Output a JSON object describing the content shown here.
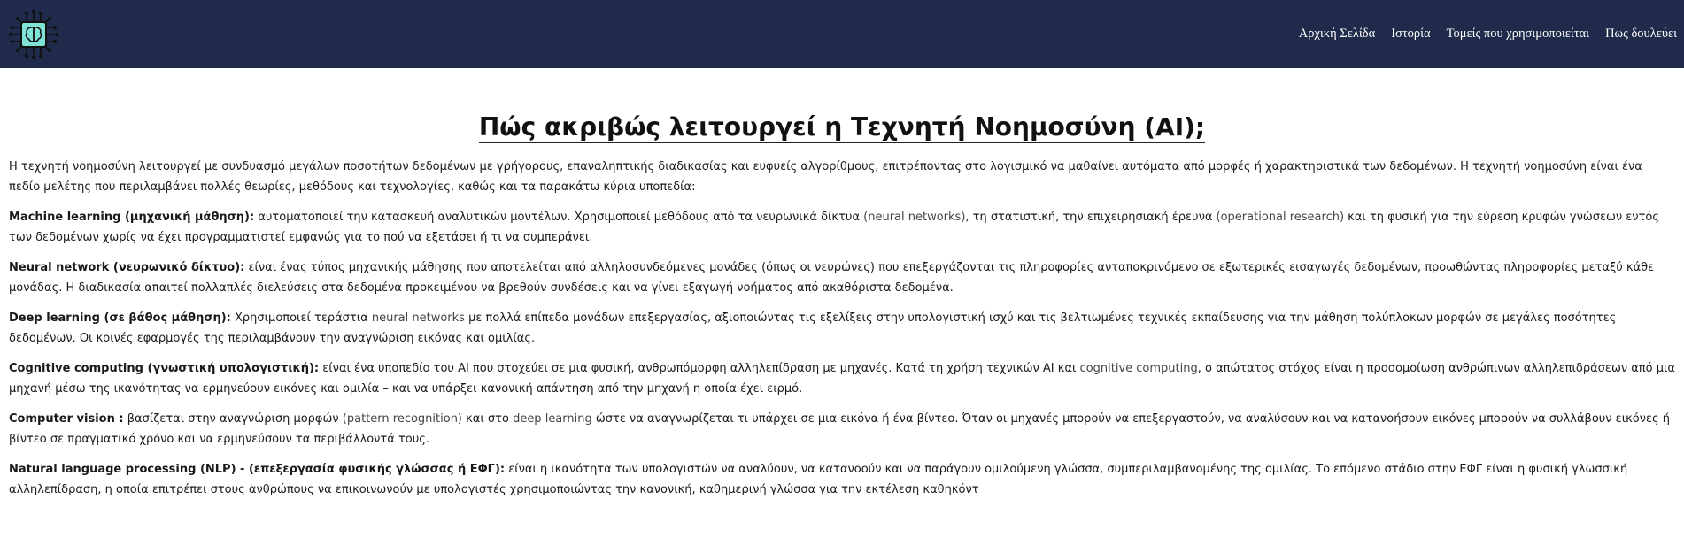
{
  "nav": {
    "links": [
      "Αρχική Σελίδα",
      "Ιστορία",
      "Τομείς που χρησιμοποιείται",
      "Πως δουλεύει"
    ]
  },
  "title": "Πώς ακριβώς λειτουργεί η Τεχνητή Νοημοσύνη (AI);",
  "intro": "Η τεχνητή νοημοσύνη λειτουργεί με συνδυασμό μεγάλων ποσοτήτων δεδομένων με γρήγορους, επαναληπτικής διαδικασίας και ευφυείς αλγορίθμους, επιτρέποντας στο λογισμικό να μαθαίνει αυτόματα από μορφές ή χαρακτηριστικά των δεδομένων. Η τεχνητή νοημοσύνη είναι ένα πεδίο μελέτης που περιλαμβάνει πολλές θεωρίες, μεθόδους και τεχνολογίες, καθώς και τα παρακάτω κύρια υποπεδία:",
  "sections": [
    {
      "term": "Machine learning (μηχανική μάθηση):",
      "parts": [
        " αυτοματοποιεί την κατασκευή αναλυτικών μοντέλων. Χρησιμοποιεί μεθόδους από τα νευρωνικά δίκτυα ",
        "(neural networks)",
        ", τη στατιστική, την επιχειρησιακή έρευνα ",
        "(operational research)",
        " και τη φυσική για την εύρεση κρυφών γνώσεων εντός των δεδομένων χωρίς να έχει προγραμματιστεί εμφανώς για το πού να εξετάσει ή τι να συμπεράνει."
      ]
    },
    {
      "term": "Neural network (νευρωνικό δίκτυο):",
      "parts": [
        " είναι ένας τύπος μηχανικής μάθησης που αποτελείται από αλληλοσυνδεόμενες μονάδες (όπως οι νευρώνες) που επεξεργάζονται τις πληροφορίες ανταποκρινόμενο σε εξωτερικές εισαγωγές δεδομένων, προωθώντας πληροφορίες μεταξύ κάθε μονάδας. Η διαδικασία απαιτεί πολλαπλές διελεύσεις στα δεδομένα προκειμένου να βρεθούν συνδέσεις και να γίνει εξαγωγή νοήματος από ακαθόριστα δεδομένα."
      ]
    },
    {
      "term": "Deep learning (σε βάθος μάθηση):",
      "parts": [
        " Χρησιμοποιεί τεράστια ",
        "neural networks",
        " με πολλά επίπεδα μονάδων επεξεργασίας, αξιοποιώντας τις εξελίξεις στην υπολογιστική ισχύ και τις βελτιωμένες τεχνικές εκπαίδευσης για την μάθηση πολύπλοκων μορφών σε μεγάλες ποσότητες δεδομένων. Οι κοινές εφαρμογές της περιλαμβάνουν την αναγνώριση εικόνας και ομιλίας."
      ]
    },
    {
      "term": "Cognitive computing (γνωστική υπολογιστική):",
      "parts": [
        " είναι ένα υποπεδίο του AI που στοχεύει σε μια φυσική, ανθρωπόμορφη αλληλεπίδραση με μηχανές. Κατά τη χρήση τεχνικών AI και ",
        "cognitive computing",
        ", ο απώτατος στόχος είναι η προσομοίωση ανθρώπινων αλληλεπιδράσεων από μια μηχανή μέσω της ικανότητας να ερμηνεύουν εικόνες και ομιλία – και να υπάρξει κανονική απάντηση από την μηχανή η οποία έχει ειρμό."
      ]
    },
    {
      "term": "Computer vision :",
      "parts": [
        " βασίζεται στην αναγνώριση μορφών ",
        "(pattern recognition)",
        " και στο ",
        "deep learning",
        " ώστε να αναγνωρίζεται τι υπάρχει σε μια εικόνα ή ένα βίντεο. Όταν οι μηχανές μπορούν να επεξεργαστούν, να αναλύσουν και να κατανοήσουν εικόνες μπορούν να συλλάβουν εικόνες ή βίντεο σε πραγματικό χρόνο και να ερμηνεύσουν τα περιβάλλοντά τους."
      ]
    },
    {
      "term": "Natural language processing (NLP) - (επεξεργασία φυσικής γλώσσας ή ΕΦΓ):",
      "parts": [
        " είναι η ικανότητα των υπολογιστών να αναλύουν, να κατανοούν και να παράγουν ομιλούμενη γλώσσα, συμπεριλαμβανομένης της ομιλίας. Το επόμενο στάδιο στην ΕΦΓ είναι η φυσική γλωσσική αλληλεπίδραση, η οποία επιτρέπει στους ανθρώπους να επικοινωνούν με υπολογιστές χρησιμοποιώντας την κανονική, καθημερινή γλώσσα για την εκτέλεση καθηκόντ"
      ]
    }
  ]
}
